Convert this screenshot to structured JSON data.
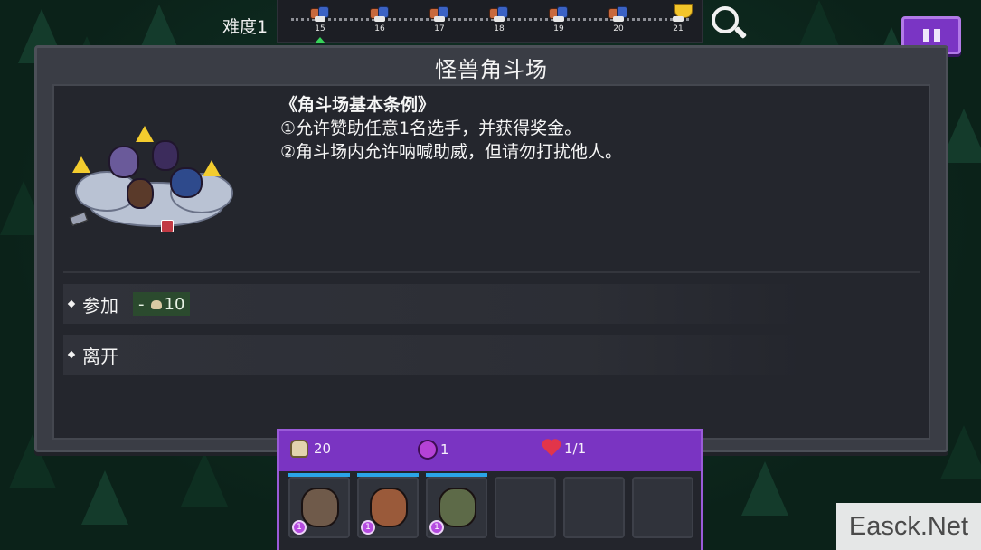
{
  "header": {
    "difficulty_label": "难度1",
    "stages": [
      {
        "number": "15",
        "current": true
      },
      {
        "number": "16",
        "current": false
      },
      {
        "number": "17",
        "current": false
      },
      {
        "number": "18",
        "current": false
      },
      {
        "number": "19",
        "current": false
      },
      {
        "number": "20",
        "current": false
      },
      {
        "number": "21",
        "current": false,
        "boss": "trophy-icon"
      }
    ],
    "search_icon": "search-icon",
    "pause_icon": "pause-icon"
  },
  "panel": {
    "title": "怪兽角斗场",
    "rules_title": "《角斗场基本条例》",
    "rule_1": "①允许赞助任意1名选手，并获得奖金。",
    "rule_2": "②角斗场内允许呐喊助威，但请勿打扰他人。",
    "options": [
      {
        "label": "参加",
        "cost_prefix": "-",
        "cost_value": "10",
        "cost_icon": "coin-bag-icon"
      },
      {
        "label": "离开"
      }
    ]
  },
  "resources": {
    "coins": "20",
    "gems": "1",
    "hearts": "1/1",
    "accent": "#7a34c2"
  },
  "team": {
    "slots": [
      {
        "filled": true,
        "level": "1"
      },
      {
        "filled": true,
        "level": "1"
      },
      {
        "filled": true,
        "level": "1"
      },
      {
        "filled": false
      },
      {
        "filled": false
      },
      {
        "filled": false
      }
    ]
  },
  "watermark": "Easck.Net"
}
